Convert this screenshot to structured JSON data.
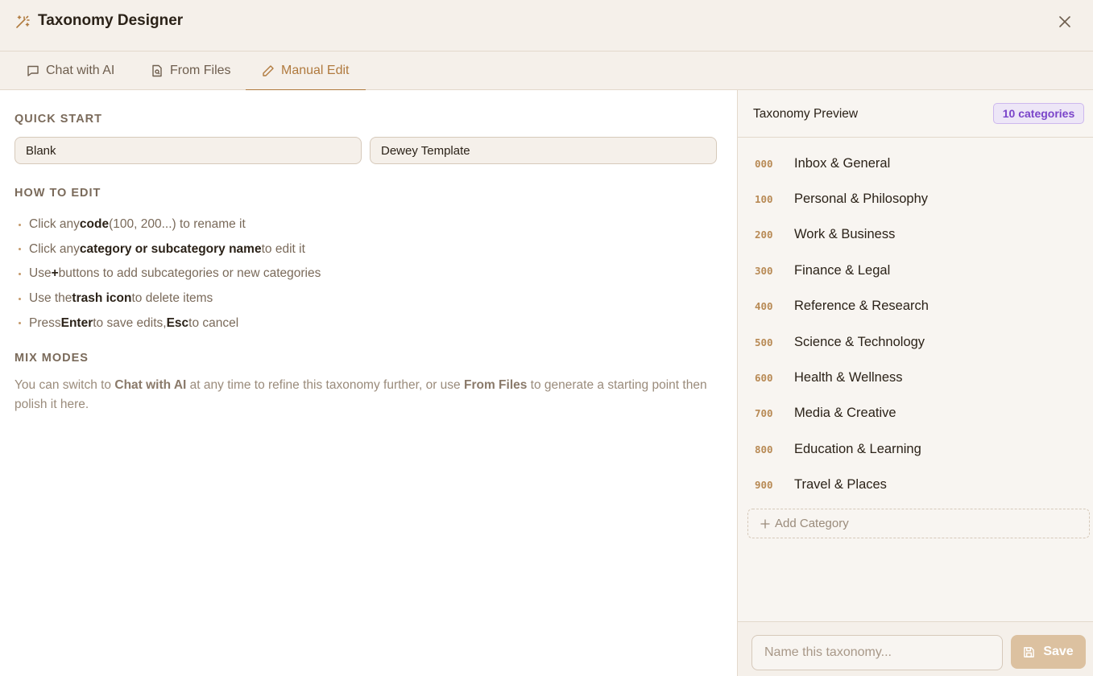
{
  "header": {
    "title": "Taxonomy Designer"
  },
  "tabs": [
    {
      "label": "Chat with AI",
      "icon": "chat-icon"
    },
    {
      "label": "From Files",
      "icon": "file-icon"
    },
    {
      "label": "Manual Edit",
      "icon": "pencil-icon",
      "active": true
    }
  ],
  "quick_start": {
    "title": "QUICK START",
    "blank_label": "Blank",
    "dewey_label": "Dewey Template"
  },
  "how_to": {
    "title": "HOW TO EDIT",
    "items": [
      {
        "pre": "Click any ",
        "bold": "code",
        "post": " (100, 200...) to rename it"
      },
      {
        "pre": "Click any ",
        "bold": "category or subcategory name",
        "post": " to edit it"
      },
      {
        "pre": "Use ",
        "bold": "+",
        "post": " buttons to add subcategories or new categories"
      },
      {
        "pre": "Use the ",
        "bold": "trash icon",
        "post": " to delete items"
      },
      {
        "pre": "Press ",
        "bold": "Enter",
        "mid": " to save edits, ",
        "bold2": "Esc",
        "post": " to cancel"
      }
    ]
  },
  "mix_modes": {
    "title": "MIX MODES",
    "t1": "You can switch to ",
    "b1": "Chat with AI",
    "t2": " at any time to refine this taxonomy further, or use ",
    "b2": "From Files",
    "t3": " to generate a starting point then polish it here."
  },
  "preview": {
    "title": "Taxonomy Preview",
    "count_badge": "10 categories",
    "categories": [
      {
        "code": "000",
        "name": "Inbox & General"
      },
      {
        "code": "100",
        "name": "Personal & Philosophy"
      },
      {
        "code": "200",
        "name": "Work & Business"
      },
      {
        "code": "300",
        "name": "Finance & Legal"
      },
      {
        "code": "400",
        "name": "Reference & Research"
      },
      {
        "code": "500",
        "name": "Science & Technology"
      },
      {
        "code": "600",
        "name": "Health & Wellness"
      },
      {
        "code": "700",
        "name": "Media & Creative"
      },
      {
        "code": "800",
        "name": "Education & Learning"
      },
      {
        "code": "900",
        "name": "Travel & Places"
      }
    ],
    "add_label": "Add Category"
  },
  "footer": {
    "name_placeholder": "Name this taxonomy...",
    "save_label": "Save"
  },
  "colors": {
    "accent": "#b07a3e",
    "badge": "#7a44c9",
    "background": "#f5f0ea"
  }
}
